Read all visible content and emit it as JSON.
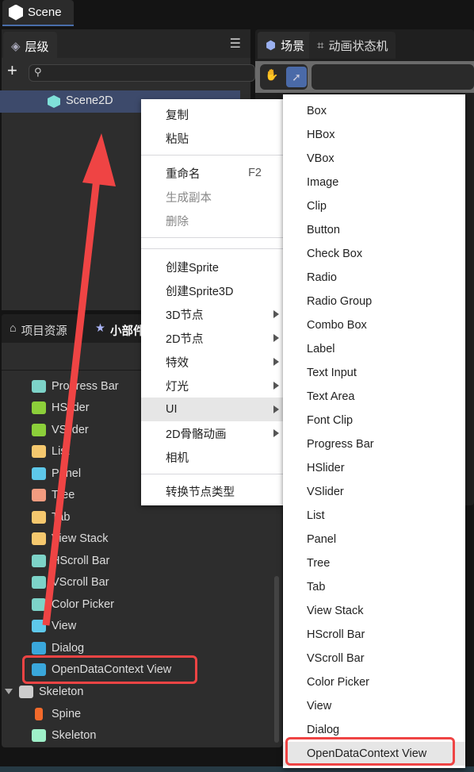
{
  "window": {
    "tab": "Scene"
  },
  "hierarchy": {
    "tab": "层级",
    "search_placeholder": "",
    "node": "Scene2D"
  },
  "scene_panel": {
    "tabs": [
      "场景",
      "动画状态机"
    ]
  },
  "assets": {
    "tabs": [
      "项目资源",
      "小部件"
    ]
  },
  "widgets": [
    {
      "label": "Progress Bar",
      "color": "#7dd3c8"
    },
    {
      "label": "HSlider",
      "color": "#8ccf3a"
    },
    {
      "label": "VSlider",
      "color": "#8ccf3a"
    },
    {
      "label": "List",
      "color": "#f5c86e"
    },
    {
      "label": "Panel",
      "color": "#5ec8ea"
    },
    {
      "label": "Tree",
      "color": "#f29c80"
    },
    {
      "label": "Tab",
      "color": "#f5c86e"
    },
    {
      "label": "View Stack",
      "color": "#f5c86e"
    },
    {
      "label": "HScroll Bar",
      "color": "#7dd3c8"
    },
    {
      "label": "VScroll Bar",
      "color": "#7dd3c8"
    },
    {
      "label": "Color Picker",
      "color": "#7dd3c8"
    },
    {
      "label": "View",
      "color": "#5ec8ea"
    },
    {
      "label": "Dialog",
      "color": "#3aa7db"
    },
    {
      "label": "OpenDataContext View",
      "color": "#3aa7db"
    }
  ],
  "skeleton_group": {
    "label": "Skeleton",
    "items": [
      {
        "label": "Spine",
        "color": "#f26a2b"
      },
      {
        "label": "Skeleton",
        "color": "#9ef0c8"
      }
    ]
  },
  "context_menu": {
    "copy": "复制",
    "paste": "粘贴",
    "rename": "重命名",
    "rename_shortcut": "F2",
    "duplicate": "生成副本",
    "delete": "删除",
    "create_sprite": "创建Sprite",
    "create_sprite3d": "创建Sprite3D",
    "node3d": "3D节点",
    "node2d": "2D节点",
    "effects": "特效",
    "light": "灯光",
    "ui": "UI",
    "skeleton2d": "2D骨骼动画",
    "camera": "相机",
    "convert": "转换节点类型"
  },
  "ui_submenu": [
    "Box",
    "HBox",
    "VBox",
    "Image",
    "Clip",
    "Button",
    "Check Box",
    "Radio",
    "Radio Group",
    "Combo Box",
    "Label",
    "Text Input",
    "Text Area",
    "Font Clip",
    "Progress Bar",
    "HSlider",
    "VSlider",
    "List",
    "Panel",
    "Tree",
    "Tab",
    "View Stack",
    "HScroll Bar",
    "VScroll Bar",
    "Color Picker",
    "View",
    "Dialog",
    "OpenDataContext View"
  ],
  "annotation_color": "#ef4444"
}
